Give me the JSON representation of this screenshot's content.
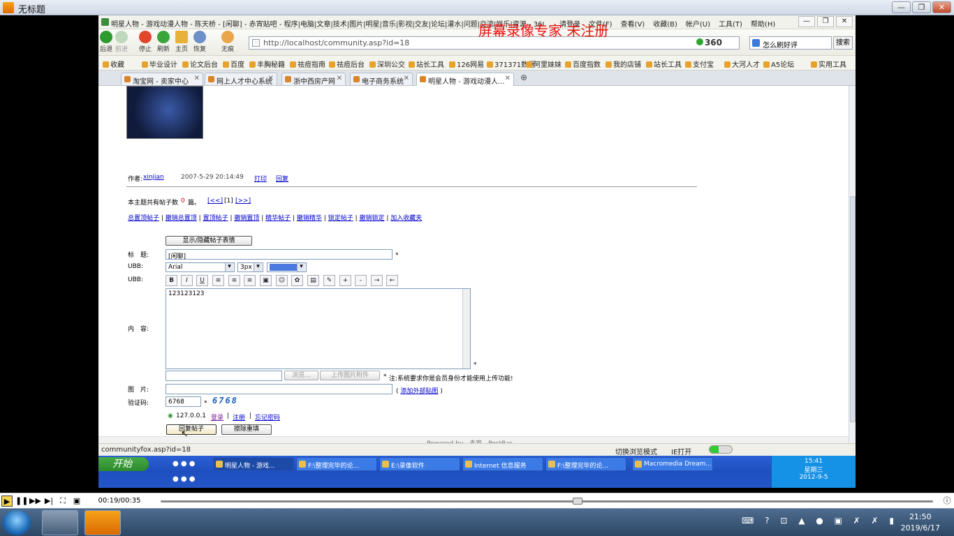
{
  "outer_window": {
    "title": "无标题"
  },
  "browser": {
    "title_bar": "明星人物 - 游戏动漫人物 - 陈天桥 - [闲聊] - 赤宵贴吧 - 程序|电脑|文章|技术|图片|明星|音乐|影视|交友|论坛|灌水|问题|交流|娱乐|资源 - 360安全浏览器",
    "menus": [
      "请登录",
      "文件(F)",
      "查看(V)",
      "收藏(B)",
      "帐户(U)",
      "工具(T)",
      "帮助(H)"
    ],
    "nav_buttons": [
      "后退",
      "前进",
      "停止",
      "刷新",
      "主页",
      "恢复",
      "无痕"
    ],
    "address": "http://localhost/community.asp?id=18",
    "address_brand": "360",
    "search_text": "怎么刷好评",
    "search_button": "搜索",
    "favorites": [
      "收藏",
      "毕业设计",
      "论文后台",
      "百度",
      "丰胸秘籍",
      "祛痘指南",
      "祛痘后台",
      "深圳公交",
      "站长工具",
      "126网易",
      "371371数据",
      "阿里妹妹",
      "百度指数",
      "我的店铺",
      "站长工具",
      "支付宝",
      "大河人才",
      "A5论坛",
      "实用工具"
    ],
    "tabs": [
      "淘宝网 - 卖家中心",
      "网上人才中心系统",
      "浙中西房产网",
      "电子商务系统",
      "明星人物 - 游戏动漫人..."
    ],
    "status_url": "communityfox.asp?id=18",
    "status_mode": "切换浏览模式",
    "status_ie": "IE打开"
  },
  "page": {
    "author_label": "作者:",
    "author_name": "xinjian",
    "post_time": "2007-5-29 20:14:49",
    "print_link": "打印",
    "reply_link": "回复",
    "post_count_prefix": "本主题共有帖子数",
    "post_count": "0",
    "post_count_suffix": "篇。",
    "pager": [
      "[<<]",
      "[1]",
      "[>>]"
    ],
    "admin_links": [
      "总置顶帖子",
      "撤销总置顶",
      "置顶帖子",
      "撤销置顶",
      "精华帖子",
      "撤销精华",
      "锁定帖子",
      "撤销锁定",
      "加入收藏夹"
    ],
    "toggle_emoticons": "显示/隐藏帖子表情",
    "title_label": "标　题:",
    "title_value": "[闲聊]",
    "ubb_label": "UBB:",
    "font_value": "Arial",
    "size_value": "3px",
    "toolbar_buttons": [
      "B",
      "I",
      "U",
      "≡",
      "≡",
      "≡",
      "▣",
      "☺",
      "✿",
      "▤",
      "✎",
      "+",
      "-",
      "→",
      "←"
    ],
    "content_label": "内　容:",
    "content_value": "123123123",
    "required_mark": "*",
    "browse_button": "浏览...",
    "upload_button": "上传图片附件",
    "upload_note": "注:系统要求你是会员身份才能使用上传功能!",
    "image_label": "图　片:",
    "external_image_link": "添加外部贴图",
    "captcha_label": "验证码:",
    "captcha_value": "6768",
    "captcha_image": "6768",
    "ip_value": "127.0.0.1",
    "login_link": "登录",
    "register_link": "注册",
    "forgot_link": "忘记密码",
    "submit_button": "回复帖子",
    "reset_button": "擦除重填",
    "footer": "Powered by　赤宵　PostBar"
  },
  "xp_taskbar": {
    "start": "开始",
    "tasks": [
      "明星人物 - 游戏...",
      "F:\\整理完毕的论...",
      "E:\\录像软件",
      "Internet 信息服务",
      "F:\\整理完毕的论...",
      "Macromedia Dream..."
    ],
    "time": "15:41",
    "weekday": "星期三",
    "date": "2012-9-5"
  },
  "player": {
    "time": "00:19/00:35",
    "progress": 0.54
  },
  "win7": {
    "time": "21:50",
    "date": "2019/6/17"
  },
  "colors": {
    "watermark": "#ee1111",
    "link": "#0000cc",
    "xp_blue": "#2456c9"
  }
}
